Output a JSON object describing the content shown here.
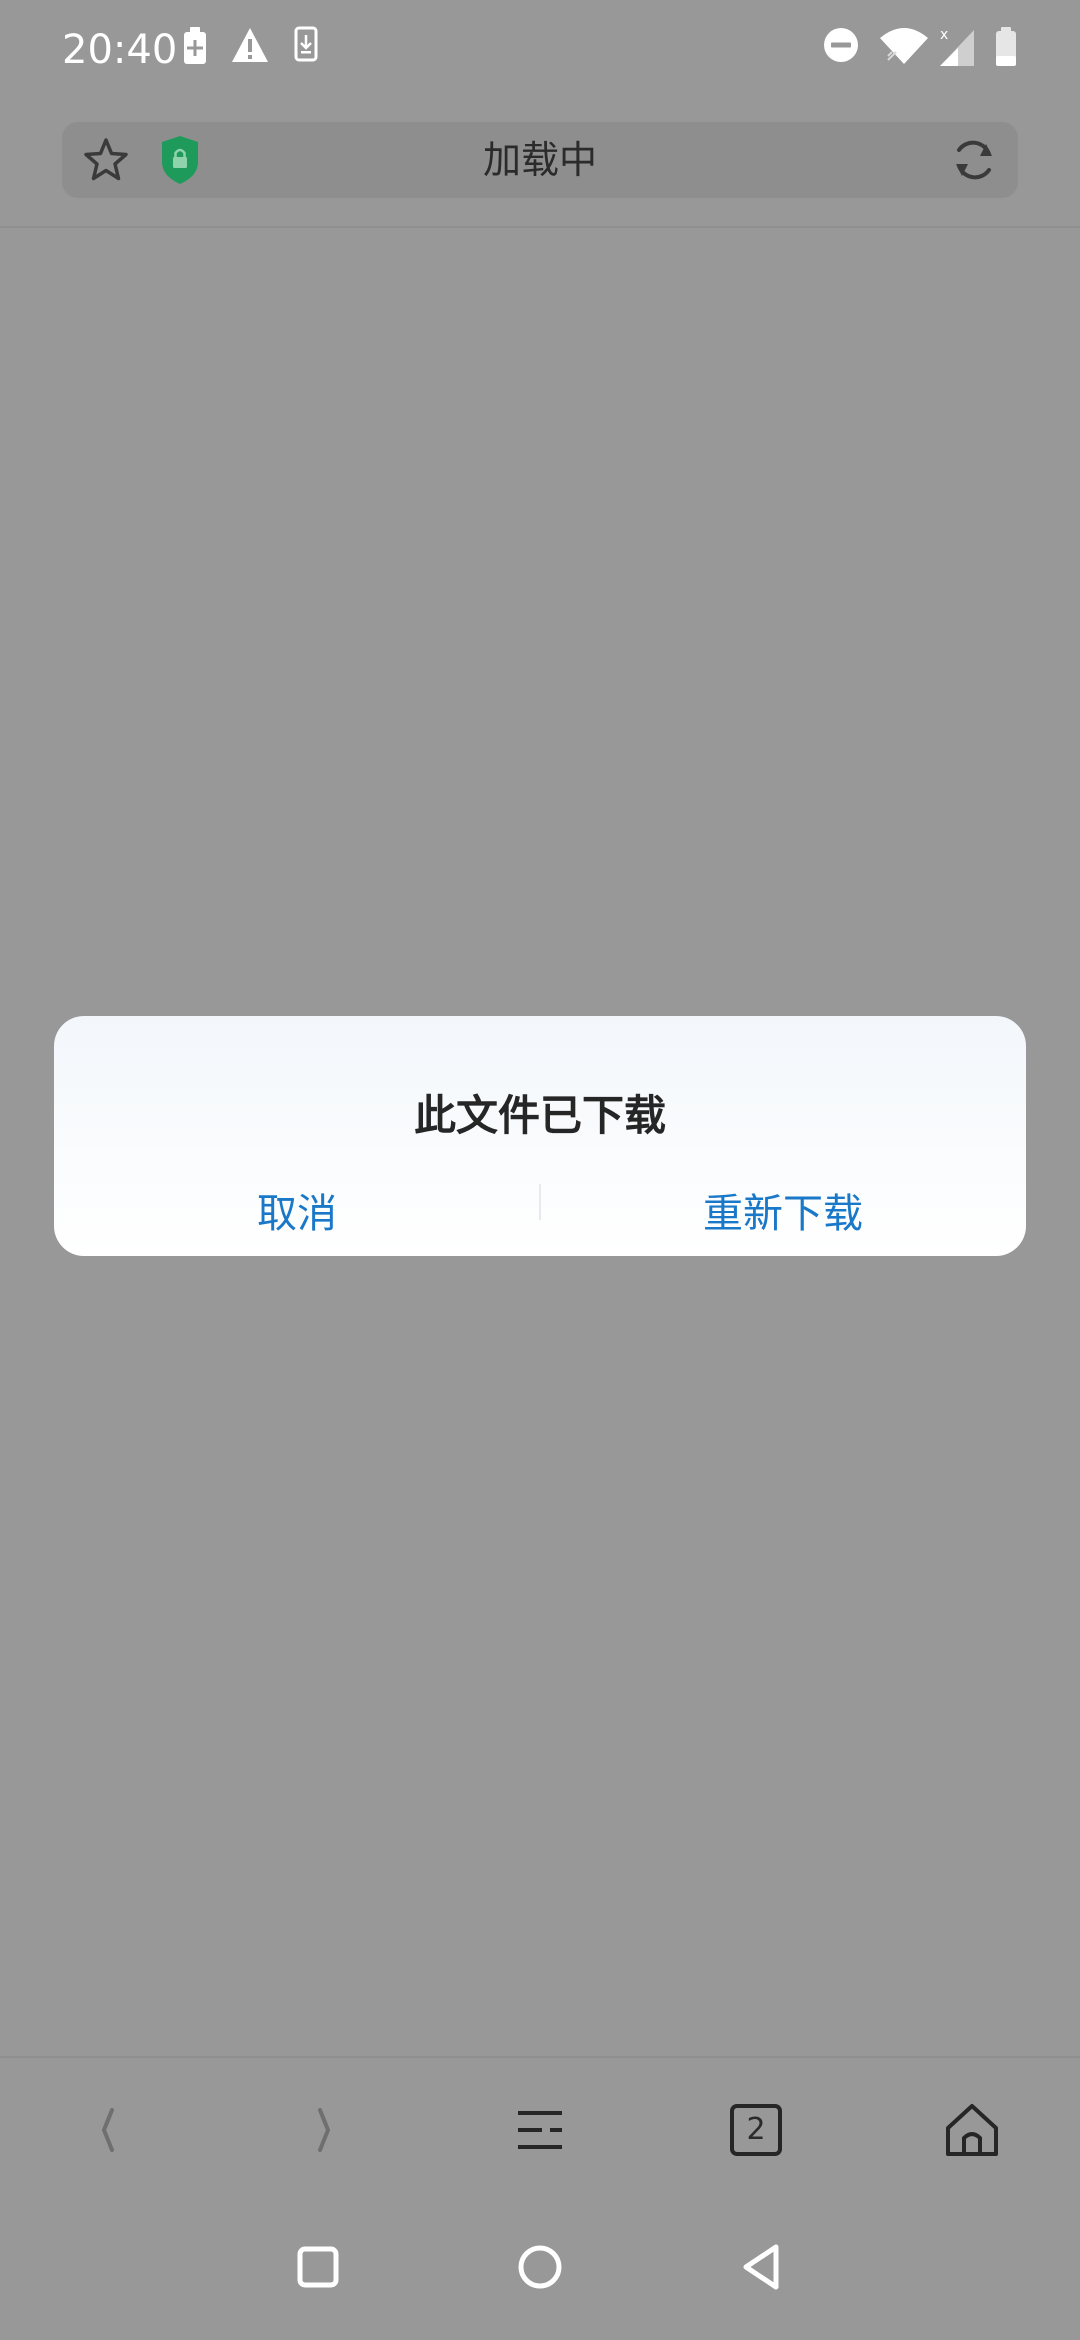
{
  "status_bar": {
    "time": "20:40",
    "icons": [
      "battery-saver-icon",
      "warning-icon",
      "download-icon",
      "dnd-icon",
      "wifi-icon",
      "signal-icon",
      "battery-icon"
    ]
  },
  "address_bar": {
    "title": "加载中",
    "icons": [
      "star-icon",
      "shield-lock-icon",
      "refresh-icon"
    ]
  },
  "dialog": {
    "title": "此文件已下载",
    "cancel_label": "取消",
    "redownload_label": "重新下载"
  },
  "bottom_toolbar": {
    "tab_count": "2",
    "icons": [
      "back-icon",
      "forward-icon",
      "menu-icon",
      "tabs-icon",
      "home-icon"
    ]
  },
  "nav_bar": {
    "icons": [
      "recents-icon",
      "home-circle-icon",
      "back-triangle-icon"
    ]
  },
  "colors": {
    "accent": "#1a78c8",
    "overlay": "#989898",
    "shield_green": "#1e9a5a"
  }
}
